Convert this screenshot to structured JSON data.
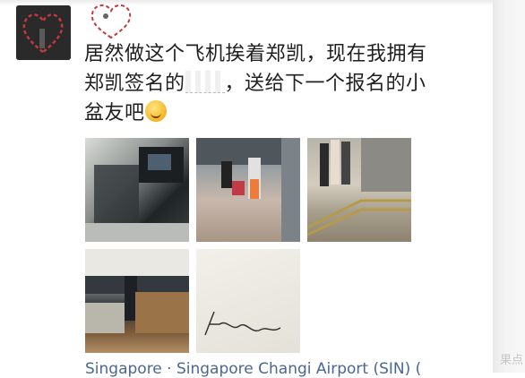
{
  "post": {
    "text_line1": "居然做这个飞机挨着郑凯，现在我拥有",
    "text_line2a": "郑凯签名的",
    "text_line2b": "，送给下一个报名的小",
    "text_line3": "盆友吧",
    "emoji": "laughing-tears-emoji"
  },
  "photos": [
    {
      "name": "cabin-seat-photo"
    },
    {
      "name": "walkway-photo"
    },
    {
      "name": "queue-photo"
    },
    {
      "name": "checkin-counter-photo"
    },
    {
      "name": "signature-paper-photo"
    }
  ],
  "location_text": "Singapore · Singapore Changi Airport (SIN) (",
  "watermark_text": "果点",
  "colors": {
    "link": "#4a6792",
    "text": "#1f1f1f"
  }
}
